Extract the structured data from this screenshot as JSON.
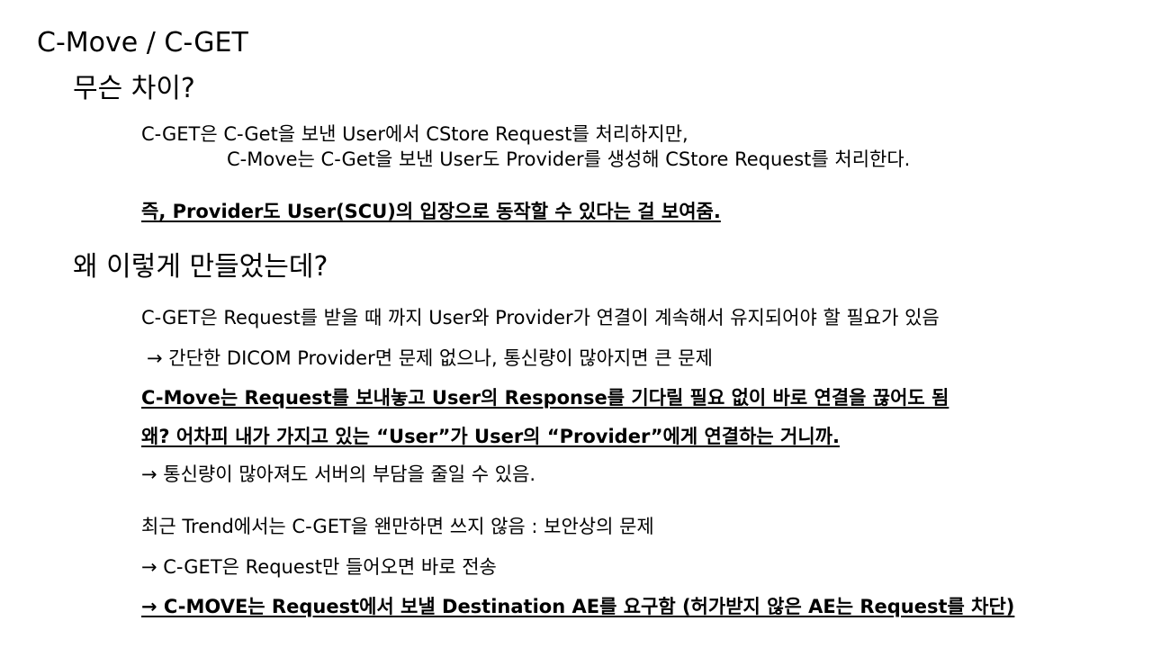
{
  "slide": {
    "title": "C-Move / C-GET",
    "section1": {
      "heading": "무슨 차이?",
      "line1": "C-GET은 C-Get을 보낸 User에서 CStore Request를 처리하지만,",
      "line2": "C-Move는 C-Get을 보낸 User도 Provider를 생성해 CStore Request를 처리한다.",
      "emphasis": "즉, Provider도 User(SCU)의 입장으로 동작할 수 있다는 걸 보여줌."
    },
    "section2": {
      "heading": "왜 이렇게 만들었는데?",
      "line1": "C-GET은 Request를 받을 때 까지 User와 Provider가 연결이 계속해서 유지되어야 할 필요가 있음",
      "line2": "→ 간단한 DICOM Provider면 문제 없으나, 통신량이 많아지면 큰 문제",
      "emphasis1": "C-Move는 Request를 보내놓고 User의 Response를 기다릴 필요 없이 바로 연결을 끊어도 됨",
      "emphasis2": "왜? 어차피 내가 가지고 있는 “User”가 User의 “Provider”에게 연결하는 거니까.",
      "line3": "→ 통신량이 많아져도 서버의 부담을 줄일 수 있음.",
      "line4": "최근 Trend에서는 C-GET을 왠만하면 쓰지 않음 : 보안상의 문제",
      "line5": "→ C-GET은 Request만 들어오면 바로 전송",
      "emphasis3": "→ C-MOVE는 Request에서 보낼 Destination AE를 요구함 (허가받지 않은 AE는 Request를 차단)"
    }
  }
}
